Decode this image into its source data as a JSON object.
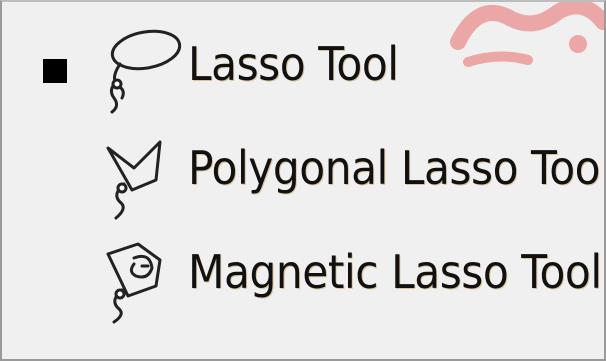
{
  "lasso_menu": {
    "items": [
      {
        "label": "Lasso Tool",
        "icon": "lasso-icon",
        "selected": true
      },
      {
        "label": "Polygonal Lasso Tool",
        "icon": "polygonal-lasso-icon",
        "selected": false
      },
      {
        "label": "Magnetic Lasso Tool",
        "icon": "magnetic-lasso-icon",
        "selected": false
      }
    ]
  },
  "colors": {
    "menu_background": "#f0f0f0",
    "text": "#111111",
    "selected_marker": "#000000",
    "watermark": "#e86a6a"
  }
}
